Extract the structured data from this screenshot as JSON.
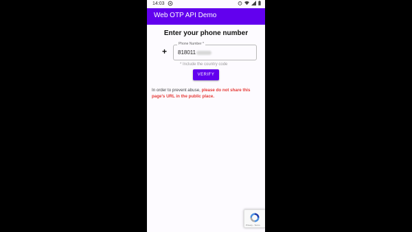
{
  "status_bar": {
    "time": "14:03",
    "icons": [
      "notification-icon",
      "alarm-icon",
      "wifi-icon",
      "signal-icon",
      "battery-icon"
    ]
  },
  "app_bar": {
    "title": "Web OTP API Demo",
    "color": "#6200ee"
  },
  "form": {
    "heading": "Enter your phone number",
    "prefix": "+",
    "phone_label": "Phone Number *",
    "phone_value_visible": "818011",
    "helper_text": "* Include the country code",
    "verify_label": "VERIFY"
  },
  "notice": {
    "text": "In order to prevent abuse, ",
    "highlight": "please do not share this page's URL in the public place.",
    "highlight_color": "#e53935"
  },
  "recaptcha": {
    "text": "Privacy - Terms"
  }
}
